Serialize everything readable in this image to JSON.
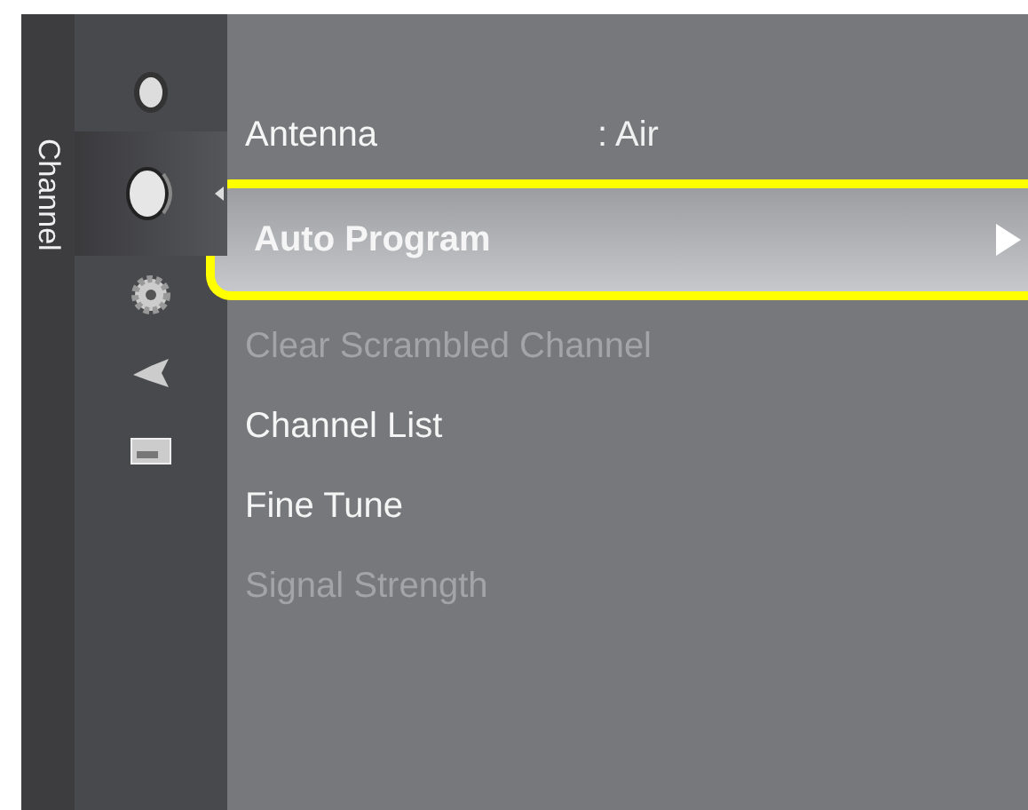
{
  "tab": {
    "label": "Channel"
  },
  "categories": [
    {
      "kind": "picture",
      "selected": false
    },
    {
      "kind": "sound",
      "selected": true
    },
    {
      "kind": "setup",
      "selected": false
    },
    {
      "kind": "input",
      "selected": false
    },
    {
      "kind": "application",
      "selected": false
    }
  ],
  "menu": [
    {
      "label": "Antenna",
      "value": ": Air",
      "selected": false,
      "disabled": false
    },
    {
      "label": "Auto Program",
      "selected": true,
      "disabled": false
    },
    {
      "label": "Clear Scrambled Channel",
      "selected": false,
      "disabled": true
    },
    {
      "label": "Channel List",
      "selected": false,
      "disabled": false
    },
    {
      "label": "Fine Tune",
      "selected": false,
      "disabled": false
    },
    {
      "label": "Signal Strength",
      "selected": false,
      "disabled": true
    }
  ]
}
